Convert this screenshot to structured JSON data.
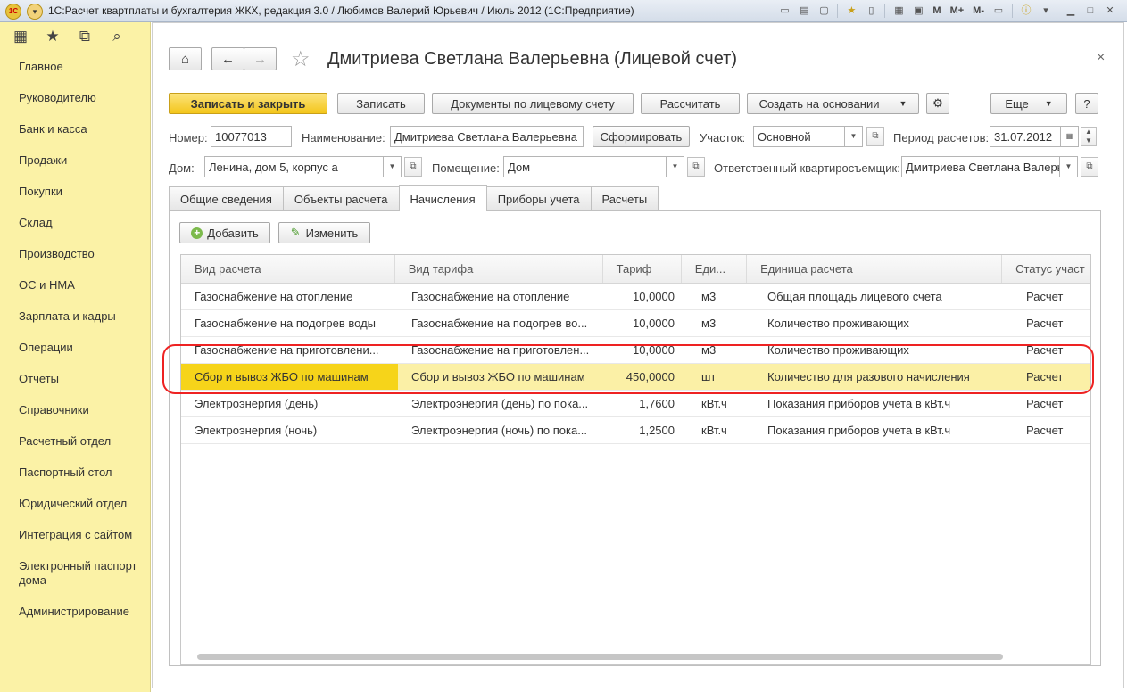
{
  "window": {
    "title": "1С:Расчет квартплаты и бухгалтерия ЖКХ, редакция 3.0 / Любимов Валерий Юрьевич / Июль 2012  (1С:Предприятие)",
    "logo": "1С",
    "toolbar_letters": [
      "M",
      "M+",
      "M-"
    ]
  },
  "sidebar": {
    "items": [
      "Главное",
      "Руководителю",
      "Банк и касса",
      "Продажи",
      "Покупки",
      "Склад",
      "Производство",
      "ОС и НМА",
      "Зарплата и кадры",
      "Операции",
      "Отчеты",
      "Справочники",
      "Расчетный отдел",
      "Паспортный стол",
      "Юридический отдел",
      "Интеграция с сайтом",
      "Электронный паспорт дома",
      "Администрирование"
    ]
  },
  "form": {
    "title": "Дмитриева Светлана Валерьевна (Лицевой счет)",
    "close_glyph": "×",
    "buttons": {
      "save_close": "Записать и закрыть",
      "save": "Записать",
      "documents": "Документы по лицевому счету",
      "calculate": "Рассчитать",
      "create_based": "Создать на основании",
      "more": "Еще",
      "help": "?",
      "generate": "Сформировать"
    },
    "fields": {
      "number_label": "Номер:",
      "number_value": "10077013",
      "name_label": "Наименование:",
      "name_value": "Дмитриева Светлана Валерьевна",
      "section_label": "Участок:",
      "section_value": "Основной",
      "period_label": "Период расчетов:",
      "period_value": "31.07.2012",
      "house_label": "Дом:",
      "house_value": "Ленина, дом 5, корпус а",
      "room_label": "Помещение:",
      "room_value": "Дом",
      "tenant_label": "Ответственный квартиросъемщик:",
      "tenant_value": "Дмитриева Светлана Валерь"
    },
    "tabs": [
      "Общие сведения",
      "Объекты расчета",
      "Начисления",
      "Приборы учета",
      "Расчеты"
    ],
    "active_tab": 2,
    "panel_buttons": {
      "add": "Добавить",
      "edit": "Изменить"
    }
  },
  "table": {
    "columns": [
      "Вид расчета",
      "Вид тарифа",
      "Тариф",
      "Еди...",
      "Единица расчета",
      "Статус участ"
    ],
    "rows": [
      [
        "Газоснабжение на отопление",
        "Газоснабжение на отопление",
        "10,0000",
        "м3",
        "Общая площадь лицевого счета",
        "Расчет"
      ],
      [
        "Газоснабжение на подогрев воды",
        "Газоснабжение на подогрев во...",
        "10,0000",
        "м3",
        "Количество проживающих",
        "Расчет"
      ],
      [
        "Газоснабжение на приготовлени...",
        "Газоснабжение на приготовлен...",
        "10,0000",
        "м3",
        "Количество проживающих",
        "Расчет"
      ],
      [
        "Сбор и вывоз ЖБО по машинам",
        "Сбор и вывоз ЖБО по машинам",
        "450,0000",
        "шт",
        "Количество для разового начисления",
        "Расчет"
      ],
      [
        "Электроэнергия (день)",
        "Электроэнергия (день) по пока...",
        "1,7600",
        "кВт.ч",
        "Показания приборов учета в кВт.ч",
        "Расчет"
      ],
      [
        "Электроэнергия (ночь)",
        "Электроэнергия (ночь) по пока...",
        "1,2500",
        "кВт.ч",
        "Показания приборов учета в кВт.ч",
        "Расчет"
      ]
    ],
    "selected_row": 3
  },
  "colors": {
    "sidebar_bg": "#fbf2a6",
    "primary_button": "#f3c61c",
    "highlight": "#e22222"
  }
}
